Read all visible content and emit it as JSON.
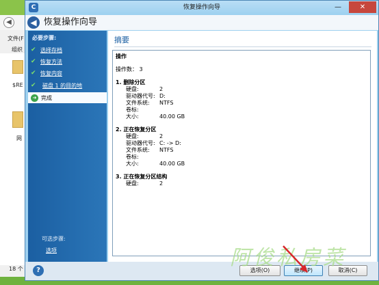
{
  "window": {
    "title": "恢复操作向导",
    "header_title": "恢复操作向导",
    "close": "✕",
    "minimize": "—"
  },
  "background": {
    "file_label": "文件(F",
    "org_label": "组织",
    "item1": "$RE",
    "item2": "网",
    "status": "18 个",
    "controls": [
      "—",
      "□",
      "✕"
    ]
  },
  "nav": {
    "required_heading": "必要步骤:",
    "steps": [
      {
        "label": "选择存档",
        "done": true
      },
      {
        "label": "恢复方法",
        "done": true
      },
      {
        "label": "恢复内容",
        "done": true
      },
      {
        "label": "磁盘 1 的目的地",
        "done": true
      }
    ],
    "current_step": "完成",
    "optional_heading": "可选步骤:",
    "optional_link": "选项"
  },
  "content": {
    "title": "摘要",
    "ops_heading": "操作",
    "ops_count": "操作数： 3",
    "sections": [
      {
        "title": "1. 删除分区",
        "rows": [
          {
            "key": "硬盘:",
            "value": "2"
          },
          {
            "key": "驱动器代号:",
            "value": "D:"
          },
          {
            "key": "文件系统:",
            "value": "NTFS"
          },
          {
            "key": "卷标:",
            "value": ""
          },
          {
            "key": "大小:",
            "value": "40.00 GB"
          }
        ]
      },
      {
        "title": "2. 正在恢复分区",
        "rows": [
          {
            "key": "硬盘:",
            "value": "2"
          },
          {
            "key": "驱动器代号:",
            "value": "C: -> D:"
          },
          {
            "key": "文件系统:",
            "value": "NTFS"
          },
          {
            "key": "卷标:",
            "value": ""
          },
          {
            "key": "大小:",
            "value": "40.00 GB"
          }
        ]
      },
      {
        "title": "3. 正在恢复分区结构",
        "rows": [
          {
            "key": "硬盘:",
            "value": "2"
          }
        ]
      }
    ]
  },
  "buttons": {
    "options": "选项(O)",
    "proceed": "继续(P)",
    "cancel": "取消(C)",
    "help": "?"
  },
  "watermark": "阿俊私房菜",
  "colors": {
    "nav_bg": "#1b5fa2",
    "check": "#7ee06c",
    "title_blue": "#1b5fa2",
    "close_red": "#c7473d"
  }
}
